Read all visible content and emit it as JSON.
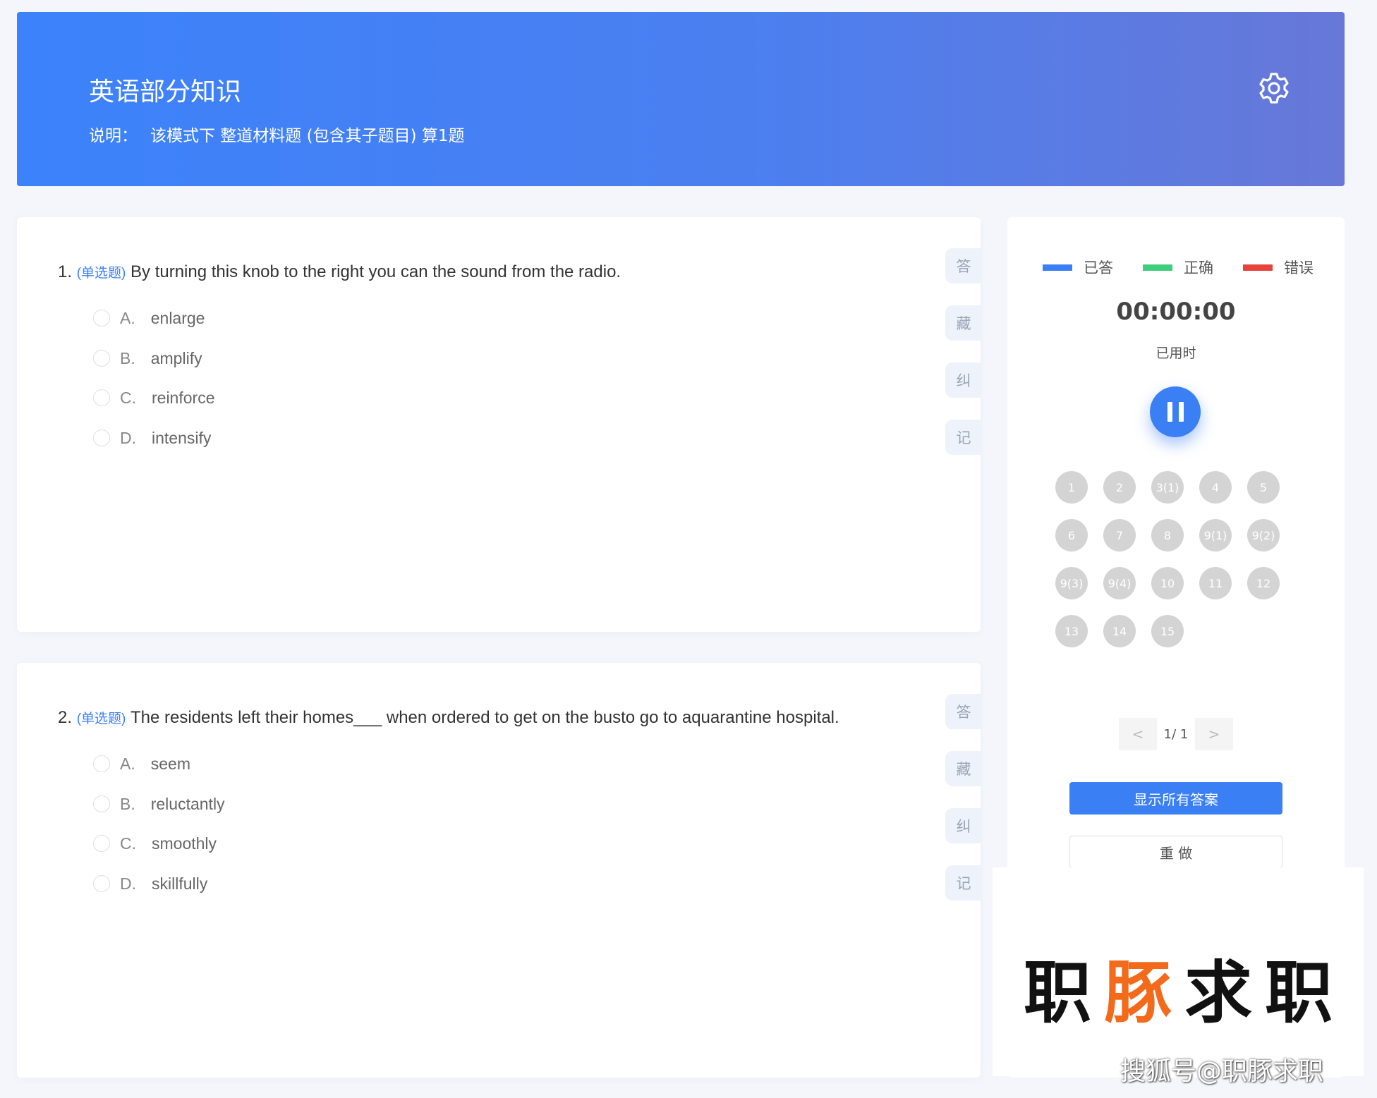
{
  "header": {
    "title": "英语部分知识",
    "desc_label": "说明：",
    "desc_text": "该模式下 整道材料题 (包含其子题目) 算1题"
  },
  "questions": [
    {
      "number": "1.",
      "type": "(单选题)",
      "stem": "By turning this knob to the right you can the sound from the radio.",
      "options": [
        {
          "letter": "A.",
          "text": "enlarge"
        },
        {
          "letter": "B.",
          "text": "amplify"
        },
        {
          "letter": "C.",
          "text": "reinforce"
        },
        {
          "letter": "D.",
          "text": "intensify"
        }
      ]
    },
    {
      "number": "2.",
      "type": "(单选题)",
      "stem": "The residents left their homes___ when ordered to get on the busto go to aquarantine hospital.",
      "options": [
        {
          "letter": "A.",
          "text": "seem"
        },
        {
          "letter": "B.",
          "text": "reluctantly"
        },
        {
          "letter": "C.",
          "text": "smoothly"
        },
        {
          "letter": "D.",
          "text": "skillfully"
        }
      ]
    }
  ],
  "side_buttons": [
    "答",
    "藏",
    "纠",
    "记"
  ],
  "legend": [
    {
      "label": "已答",
      "color": "#3b7ff5"
    },
    {
      "label": "正确",
      "color": "#3ecf7e"
    },
    {
      "label": "错误",
      "color": "#e8433b"
    }
  ],
  "timer": {
    "value": "00:00:00",
    "label": "已用时"
  },
  "answer_sheet": [
    "1",
    "2",
    "3(1)",
    "4",
    "5",
    "6",
    "7",
    "8",
    "9(1)",
    "9(2)",
    "9(3)",
    "9(4)",
    "10",
    "11",
    "12",
    "13",
    "14",
    "15"
  ],
  "pager": {
    "prev": "<",
    "text": "1/ 1",
    "next": ">"
  },
  "buttons": {
    "show_all": "显示所有答案",
    "redo": "重 做"
  },
  "watermark": {
    "c1": "职",
    "c2": "豚",
    "c3": "求",
    "c4": "职",
    "credit": "搜狐号@职豚求职"
  }
}
